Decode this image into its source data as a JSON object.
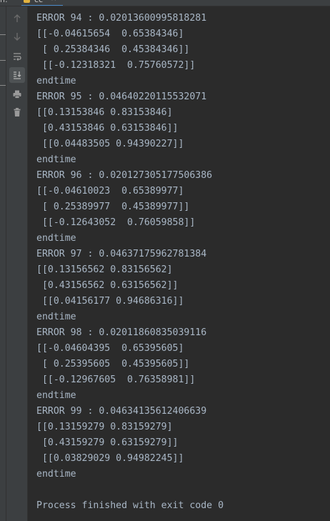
{
  "tab": {
    "partial_text": "n:",
    "run_label": "cc",
    "close_glyph": "×"
  },
  "toolbar": {
    "buttons": [
      {
        "icon": "up-arrow-icon",
        "name": "scroll-up-button",
        "active": false
      },
      {
        "icon": "down-arrow-icon",
        "name": "scroll-down-button",
        "active": false
      },
      {
        "icon": "soft-wrap-icon",
        "name": "soft-wrap-button",
        "active": false
      },
      {
        "icon": "scroll-to-end-icon",
        "name": "scroll-to-end-button",
        "active": true
      },
      {
        "icon": "print-icon",
        "name": "print-button",
        "active": false
      },
      {
        "icon": "trash-icon",
        "name": "clear-all-button",
        "active": false
      }
    ]
  },
  "console": {
    "lines": [
      "ERROR 94 : 0.02013600995818281",
      "[[-0.04615654  0.65384346]",
      " [ 0.25384346  0.45384346]]",
      " [[-0.12318321  0.75760572]]",
      "endtime",
      "ERROR 95 : 0.04640220115532071",
      "[[0.13153846 0.83153846]",
      " [0.43153846 0.63153846]]",
      " [[0.04483505 0.94390227]]",
      "endtime",
      "ERROR 96 : 0.020127305177506386",
      "[[-0.04610023  0.65389977]",
      " [ 0.25389977  0.45389977]]",
      " [[-0.12643052  0.76059858]]",
      "endtime",
      "ERROR 97 : 0.04637175962781384",
      "[[0.13156562 0.83156562]",
      " [0.43156562 0.63156562]]",
      " [[0.04156177 0.94686316]]",
      "endtime",
      "ERROR 98 : 0.02011860835039116",
      "[[-0.04604395  0.65395605]",
      " [ 0.25395605  0.45395605]]",
      " [[-0.12967605  0.76358981]]",
      "endtime",
      "ERROR 99 : 0.04634135612406639",
      "[[0.13159279 0.83159279]",
      " [0.43159279 0.63159279]]",
      " [[0.03829029 0.94982245]]",
      "endtime",
      "",
      "Process finished with exit code 0"
    ]
  },
  "colors": {
    "background": "#2b2b2b",
    "panel": "#3c3f41",
    "text": "#a9b7c6",
    "icon": "#8a8a8a",
    "tab_underline": "#4a88c7",
    "python_icon": "#e2b33f"
  }
}
